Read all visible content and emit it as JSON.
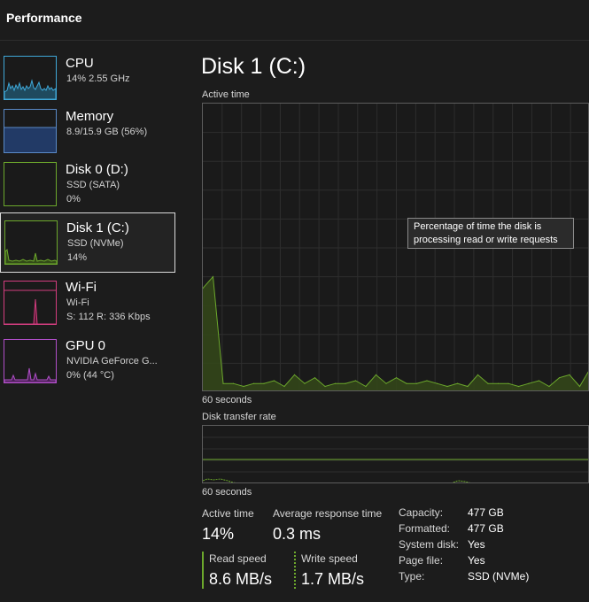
{
  "header": {
    "title": "Performance"
  },
  "colors": {
    "cpu": "#3fa8d8",
    "memory": "#5a8ac8",
    "disk": "#6ca82c",
    "wifi": "#d33d7f",
    "gpu": "#b04fc8"
  },
  "sidebar": {
    "items": [
      {
        "name": "CPU",
        "line1": "14% 2.55 GHz",
        "line2": ""
      },
      {
        "name": "Memory",
        "line1": "8.9/15.9 GB (56%)",
        "line2": ""
      },
      {
        "name": "Disk 0 (D:)",
        "line1": "SSD (SATA)",
        "line2": "0%"
      },
      {
        "name": "Disk 1 (C:)",
        "line1": "SSD (NVMe)",
        "line2": "14%"
      },
      {
        "name": "Wi-Fi",
        "line1": "Wi-Fi",
        "line2": "S: 112 R: 336 Kbps"
      },
      {
        "name": "GPU 0",
        "line1": "NVIDIA GeForce G...",
        "line2": "0% (44 °C)"
      }
    ]
  },
  "main": {
    "title": "Disk 1 (C:)",
    "active_time_label": "Active time",
    "graph1_footer": "60 seconds",
    "transfer_label": "Disk transfer rate",
    "graph2_footer": "60 seconds",
    "tooltip": {
      "line1": "Percentage of time the disk is",
      "line2": "processing read or write requests"
    },
    "stats": {
      "active_time_label": "Active time",
      "active_time_value": "14%",
      "avg_response_label": "Average response time",
      "avg_response_value": "0.3 ms",
      "read_speed_label": "Read speed",
      "read_speed_value": "8.6 MB/s",
      "write_speed_label": "Write speed",
      "write_speed_value": "1.7 MB/s"
    },
    "info": [
      {
        "key": "Capacity:",
        "value": "477 GB"
      },
      {
        "key": "Formatted:",
        "value": "477 GB"
      },
      {
        "key": "System disk:",
        "value": "Yes"
      },
      {
        "key": "Page file:",
        "value": "Yes"
      },
      {
        "key": "Type:",
        "value": "SSD (NVMe)"
      }
    ]
  },
  "chart_data": {
    "type": "area",
    "xlabel": "60 seconds",
    "ylim": [
      0,
      100
    ],
    "series": [
      {
        "values": [
          36,
          40,
          3,
          3,
          2,
          3,
          3,
          4,
          2,
          6,
          3,
          5,
          2,
          3,
          3,
          4,
          2,
          6,
          3,
          5,
          3,
          3,
          4,
          3,
          2,
          3,
          2,
          6,
          3,
          3,
          3,
          2,
          3,
          4,
          2,
          5,
          6,
          2,
          8
        ]
      }
    ]
  }
}
